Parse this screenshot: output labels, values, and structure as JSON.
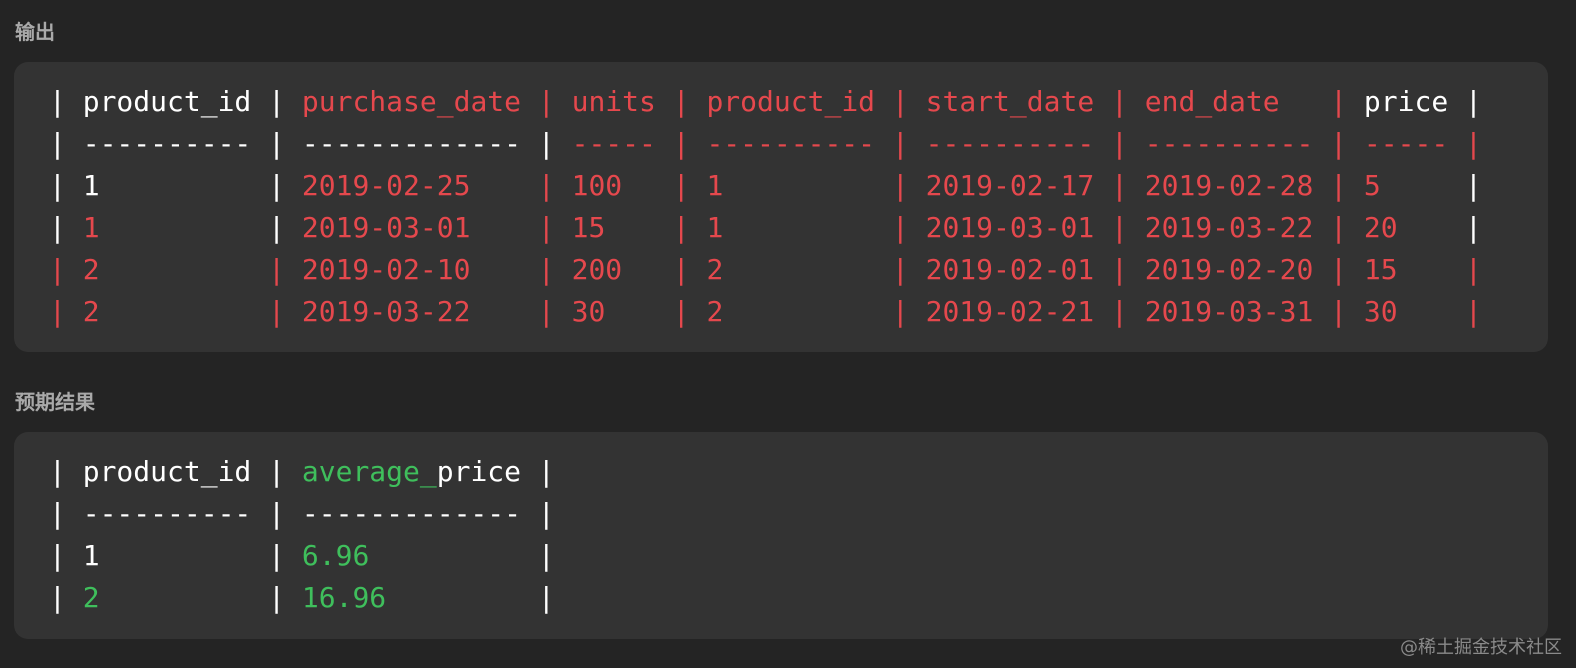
{
  "output_section": {
    "label": "输出",
    "table_lines": [
      [
        {
          "t": "| ",
          "c": "w"
        },
        {
          "t": "product_id",
          "c": "w"
        },
        {
          "t": " | ",
          "c": "w"
        },
        {
          "t": "purchase_date | units | product_id | start_date | end_date   |",
          "c": "r"
        },
        {
          "t": " price |",
          "c": "w"
        }
      ],
      [
        {
          "t": "| ---------- | ------------- |",
          "c": "w"
        },
        {
          "t": " ----- | ---------- | ---------- | ---------- | ----- |",
          "c": "r"
        }
      ],
      [
        {
          "t": "| 1          | ",
          "c": "w"
        },
        {
          "t": "2019-02-25    | 100   | 1          | 2019-02-17 | 2019-02-28 | 5",
          "c": "r"
        },
        {
          "t": "     |",
          "c": "w"
        }
      ],
      [
        {
          "t": "| ",
          "c": "w"
        },
        {
          "t": "1",
          "c": "r"
        },
        {
          "t": "          | ",
          "c": "w"
        },
        {
          "t": "2019-03-01    | 15    | 1          | 2019-03-01 | 2019-03-22 | 20",
          "c": "r"
        },
        {
          "t": "    |",
          "c": "w"
        }
      ],
      [
        {
          "t": "| 2          | 2019-02-10    | 200   | 2          | 2019-02-01 | 2019-02-20 | 15    |",
          "c": "r"
        }
      ],
      [
        {
          "t": "| 2          | 2019-03-22    | 30    | 2          | 2019-02-21 | 2019-03-31 | 30    |",
          "c": "r"
        }
      ]
    ]
  },
  "expected_section": {
    "label": "预期结果",
    "table_lines": [
      [
        {
          "t": "| product_id | ",
          "c": "w"
        },
        {
          "t": "average_",
          "c": "g"
        },
        {
          "t": "price |",
          "c": "w"
        }
      ],
      [
        {
          "t": "| ---------- | ------------- |",
          "c": "w"
        }
      ],
      [
        {
          "t": "| 1          | ",
          "c": "w"
        },
        {
          "t": "6.96",
          "c": "g"
        },
        {
          "t": "          |",
          "c": "w"
        }
      ],
      [
        {
          "t": "| ",
          "c": "w"
        },
        {
          "t": "2",
          "c": "g"
        },
        {
          "t": "          | ",
          "c": "w"
        },
        {
          "t": "16.96",
          "c": "g"
        },
        {
          "t": "         |",
          "c": "w"
        }
      ]
    ]
  },
  "watermark": "@稀土掘金技术社区",
  "colors": {
    "background": "#242424",
    "code_background": "#333333",
    "label": "#a9a9a9",
    "text_white": "#ffffff",
    "diff_red": "#e5484d",
    "diff_green": "#3fbf5c"
  }
}
